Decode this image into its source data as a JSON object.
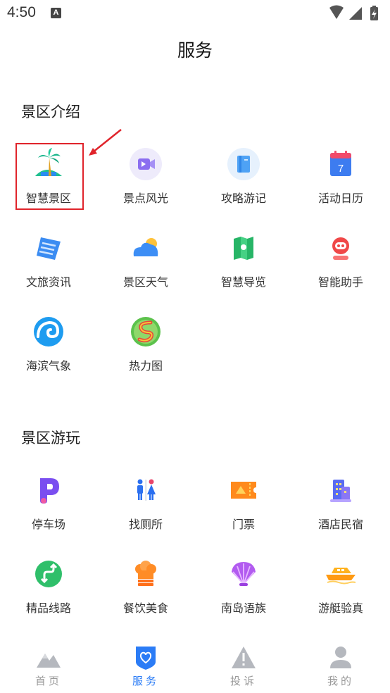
{
  "status_bar": {
    "time": "4:50",
    "notification_letter": "A"
  },
  "page": {
    "title": "服务"
  },
  "sections": [
    {
      "title": "景区介绍",
      "items": [
        {
          "label": "智慧景区",
          "icon": "palm-island-icon"
        },
        {
          "label": "景点风光",
          "icon": "video-camera-icon"
        },
        {
          "label": "攻略游记",
          "icon": "book-icon"
        },
        {
          "label": "活动日历",
          "icon": "calendar-icon",
          "calendar_day": "7"
        },
        {
          "label": "文旅资讯",
          "icon": "news-scroll-icon"
        },
        {
          "label": "景区天气",
          "icon": "weather-cloud-icon"
        },
        {
          "label": "智慧导览",
          "icon": "map-guide-icon"
        },
        {
          "label": "智能助手",
          "icon": "robot-assistant-icon"
        },
        {
          "label": "海滨气象",
          "icon": "wave-icon"
        },
        {
          "label": "热力图",
          "icon": "heatmap-icon"
        }
      ]
    },
    {
      "title": "景区游玩",
      "items": [
        {
          "label": "停车场",
          "icon": "parking-icon"
        },
        {
          "label": "找厕所",
          "icon": "restroom-icon"
        },
        {
          "label": "门票",
          "icon": "ticket-icon"
        },
        {
          "label": "酒店民宿",
          "icon": "hotel-building-icon"
        },
        {
          "label": "精品线路",
          "icon": "route-icon"
        },
        {
          "label": "餐饮美食",
          "icon": "chef-hat-icon"
        },
        {
          "label": "南岛语族",
          "icon": "shell-icon"
        },
        {
          "label": "游艇验真",
          "icon": "yacht-icon"
        }
      ]
    }
  ],
  "tab_bar": {
    "tabs": [
      {
        "label": "首页",
        "icon": "mountain-home-icon",
        "active": false
      },
      {
        "label": "服务",
        "icon": "heart-shield-icon",
        "active": true
      },
      {
        "label": "投诉",
        "icon": "warning-triangle-icon",
        "active": false
      },
      {
        "label": "我的",
        "icon": "user-profile-icon",
        "active": false
      }
    ]
  },
  "colors": {
    "accent": "#2b7cf6",
    "highlight": "#e0242b",
    "tab_inactive": "#999999"
  }
}
